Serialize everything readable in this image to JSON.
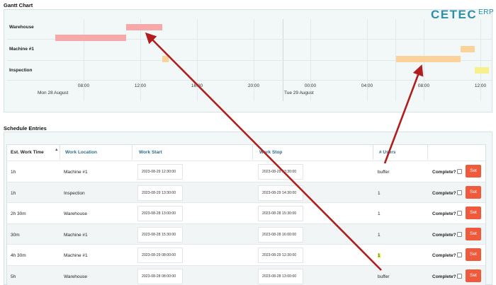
{
  "gantt": {
    "title": "Gantt Chart",
    "logo": {
      "main": "CETEC",
      "sub": "ERP",
      "color": "#2a8fa9"
    },
    "rows": [
      "Warehouse",
      "Machine #1",
      "Inspection"
    ],
    "ticks": [
      "08:00",
      "12:00",
      "16:00",
      "20:00",
      "00:00",
      "04:00",
      "08:00",
      "12:00"
    ],
    "days": [
      "Mon 28 August",
      "Tue 29 August"
    ],
    "bar_colors": {
      "warehouse": "#f7a9a9",
      "machine": "#fbd39a",
      "inspection_highlight": "#f8f08a"
    }
  },
  "schedule": {
    "title": "Schedule Entries",
    "columns": [
      "Est. Work Time",
      "Work Location",
      "Work Start",
      "Work Stop",
      "# Users"
    ],
    "complete_label": "Complete?",
    "set_label": "Set",
    "rows": [
      {
        "time": "1h",
        "location": "Machine #1",
        "start": "2023-08-29 12:30:00",
        "stop": "2023-08-29 13:30:00",
        "users": "buffer"
      },
      {
        "time": "1h",
        "location": "Inspection",
        "start": "2023-08-29 13:30:00",
        "stop": "2023-08-29 14:30:00",
        "users": "1"
      },
      {
        "time": "2h 30m",
        "location": "Warehouse",
        "start": "2023-08-28 13:00:00",
        "stop": "2023-08-28 15:30:00",
        "users": "1"
      },
      {
        "time": "30m",
        "location": "Machine #1",
        "start": "2023-08-28 15:30:00",
        "stop": "2023-08-28 16:00:00",
        "users": "1"
      },
      {
        "time": "4h 30m",
        "location": "Machine #1",
        "start": "2023-08-29 08:00:00",
        "stop": "2023-08-29 12:30:00",
        "users": "1"
      },
      {
        "time": "5h",
        "location": "Warehouse",
        "start": "2023-08-28 08:00:00",
        "stop": "2023-08-28 13:00:00",
        "users": "buffer"
      }
    ]
  },
  "annotation_color": "#b01e1e"
}
